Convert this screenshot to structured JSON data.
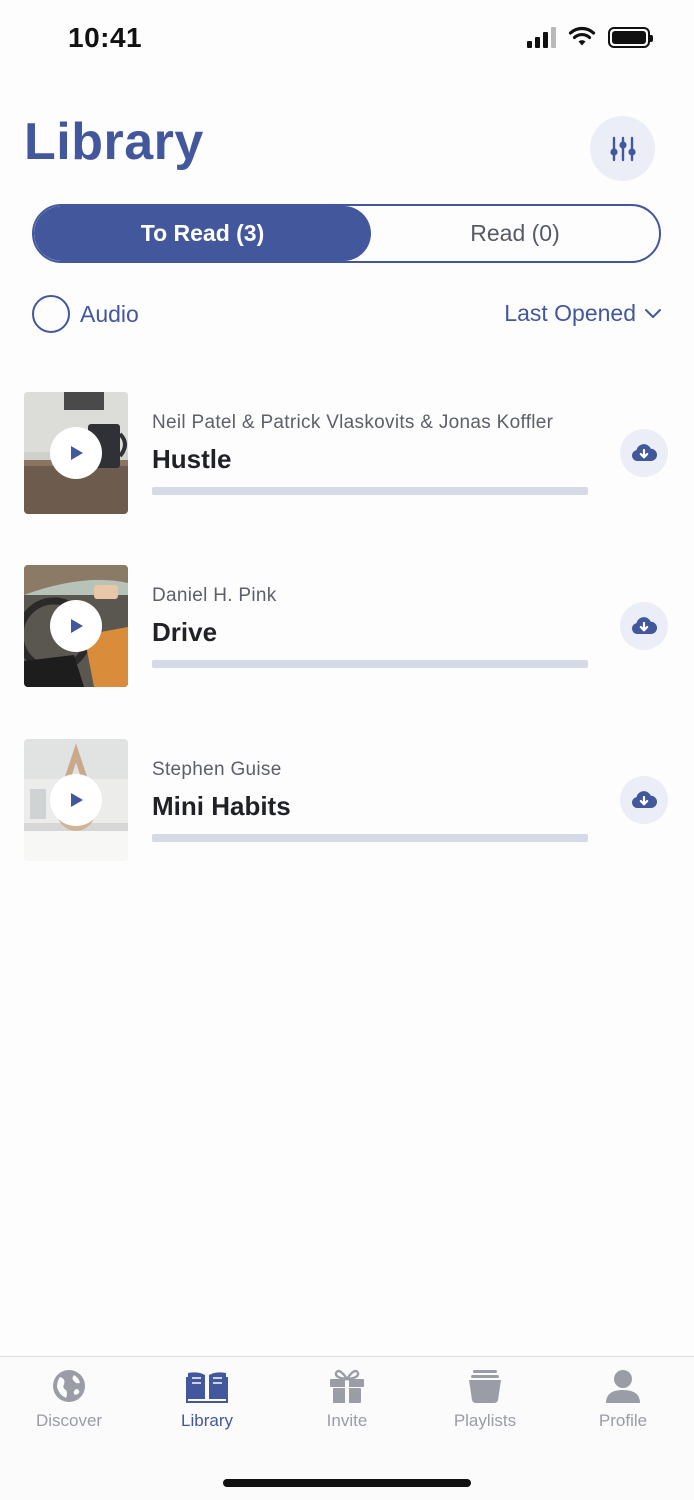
{
  "status_bar": {
    "time": "10:41"
  },
  "header": {
    "title": "Library",
    "filter_icon": "sliders-icon"
  },
  "segments": [
    {
      "label": "To Read (3)",
      "active": true
    },
    {
      "label": "Read (0)",
      "active": false
    }
  ],
  "options": {
    "audio_label": "Audio",
    "sort_label": "Last Opened"
  },
  "books": [
    {
      "author": "Neil Patel &  Patrick Vlaskovits & Jonas Koffler",
      "title": "Hustle",
      "progress": 0
    },
    {
      "author": "Daniel H. Pink",
      "title": "Drive",
      "progress": 0
    },
    {
      "author": "Stephen Guise",
      "title": "Mini Habits",
      "progress": 0
    }
  ],
  "tabbar": [
    {
      "label": "Discover",
      "icon": "globe-icon",
      "active": false
    },
    {
      "label": "Library",
      "icon": "book-icon",
      "active": true
    },
    {
      "label": "Invite",
      "icon": "gift-icon",
      "active": false
    },
    {
      "label": "Playlists",
      "icon": "playlist-stack-icon",
      "active": false
    },
    {
      "label": "Profile",
      "icon": "person-icon",
      "active": false
    }
  ],
  "colors": {
    "accent": "#43579c",
    "inactive_tab": "#9a9ca6",
    "progress_track": "#d6dae6"
  }
}
